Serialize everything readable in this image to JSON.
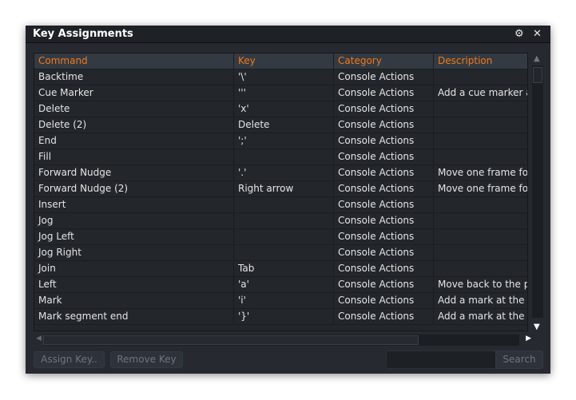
{
  "window": {
    "title": "Key Assignments",
    "icons": [
      "gears-icon",
      "close-icon"
    ]
  },
  "table": {
    "columns": [
      "Command",
      "Key",
      "Category",
      "Description"
    ],
    "rows": [
      [
        "Backtime",
        "'\\'",
        "Console Actions",
        ""
      ],
      [
        "Cue Marker",
        "'''",
        "Console Actions",
        "Add a cue marker a"
      ],
      [
        "Delete",
        "'x'",
        "Console Actions",
        ""
      ],
      [
        "Delete (2)",
        "Delete",
        "Console Actions",
        ""
      ],
      [
        "End",
        "';'",
        "Console Actions",
        ""
      ],
      [
        "Fill",
        "",
        "Console Actions",
        ""
      ],
      [
        "Forward Nudge",
        "'.'",
        "Console Actions",
        "Move one frame for"
      ],
      [
        "Forward Nudge (2)",
        "Right arrow",
        "Console Actions",
        "Move one frame for"
      ],
      [
        "Insert",
        "",
        "Console Actions",
        ""
      ],
      [
        "Jog",
        "",
        "Console Actions",
        ""
      ],
      [
        "Jog Left",
        "",
        "Console Actions",
        ""
      ],
      [
        "Jog Right",
        "",
        "Console Actions",
        ""
      ],
      [
        "Join",
        "Tab",
        "Console Actions",
        ""
      ],
      [
        "Left",
        "'a'",
        "Console Actions",
        "Move back to the pr"
      ],
      [
        "Mark",
        "'i'",
        "Console Actions",
        "Add a mark at the c"
      ],
      [
        "Mark segment end",
        "'}'",
        "Console Actions",
        "Add a mark at the e"
      ]
    ]
  },
  "footer": {
    "assign_label": "Assign Key..",
    "remove_label": "Remove Key",
    "search_value": "",
    "search_label": "Search"
  },
  "colors": {
    "accent": "#f07a1c",
    "background": "#262a30"
  }
}
